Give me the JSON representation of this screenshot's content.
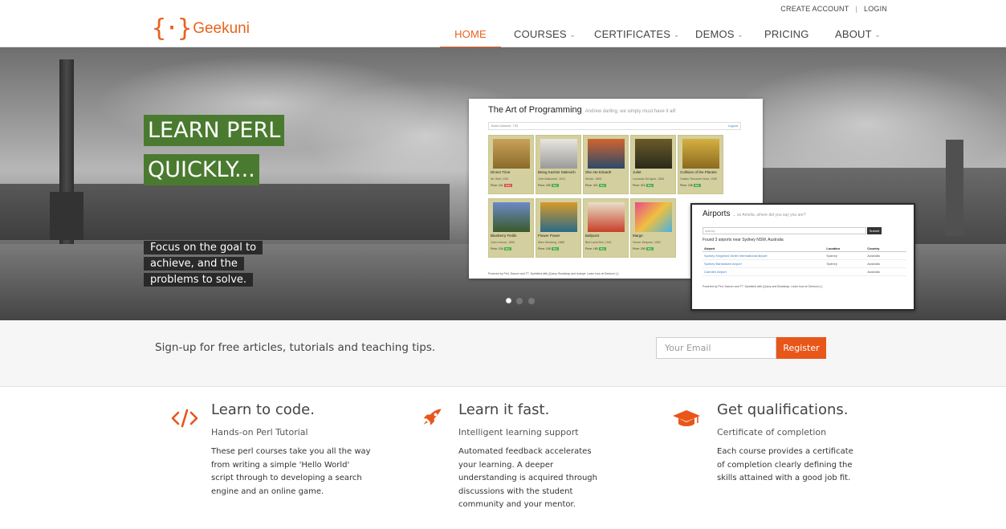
{
  "brand": {
    "mark": "{·}",
    "name": "Geekuni",
    "accent": "#e8631e"
  },
  "toplinks": {
    "create_account": "CREATE ACCOUNT",
    "separator": "|",
    "login": "LOGIN"
  },
  "nav": {
    "items": [
      {
        "label": "HOME",
        "active": true,
        "dropdown": false
      },
      {
        "label": "COURSES",
        "active": false,
        "dropdown": true
      },
      {
        "label": "CERTIFICATES",
        "active": false,
        "dropdown": true
      },
      {
        "label": "DEMOS",
        "active": false,
        "dropdown": true
      },
      {
        "label": "PRICING",
        "active": false,
        "dropdown": false
      },
      {
        "label": "ABOUT",
        "active": false,
        "dropdown": true
      }
    ],
    "chevron": "⌄"
  },
  "hero": {
    "title_line1": "LEARN PERL",
    "title_line2": "QUICKLY...",
    "subtitle": "Focus on the goal to achieve, and the problems to solve.",
    "title_bg": "#4a7a2f",
    "slide_count": 3,
    "active_slide": 1
  },
  "shot1": {
    "title": "The Art of Programming",
    "tagline": "Andrew darling, we simply must have it all!",
    "balance": "Bank balance: 733",
    "logout": "Logout",
    "cards": [
      {
        "name": "Dinner Time",
        "author": "Mr. Wolf, 1931",
        "price": "Price: 161",
        "tag": "Sold",
        "tag_color": "red"
      },
      {
        "name": "Being Kazimir Malevich",
        "author": "John Malkovich, 1913",
        "price": "Price: 180",
        "tag": "Buy",
        "tag_color": "green"
      },
      {
        "name": "She Ate Edvard!",
        "author": "Munch, 1893",
        "price": "Price: 321",
        "tag": "Buy",
        "tag_color": "green"
      },
      {
        "name": "Juliet",
        "author": "Leonardo DiCaprio, 1506",
        "price": "Price: 310",
        "tag": "Buy",
        "tag_color": "green"
      },
      {
        "name": "Collision of the Planets",
        "author": "Gustav Theodore Holst, 1908",
        "price": "Price: 238",
        "tag": "Buy",
        "tag_color": "green"
      },
      {
        "name": "Blueberry Fields",
        "author": "John Lennon, 1890",
        "price": "Price: 234",
        "tag": "Buy",
        "tag_color": "green"
      },
      {
        "name": "Flower Power",
        "author": "Allen Ginsberg, 1888",
        "price": "Price: 155",
        "tag": "Buy",
        "tag_color": "green"
      },
      {
        "name": "Ballpoint",
        "author": "Bird Lásló Biró, 1940",
        "price": "Price: 180",
        "tag": "Buy",
        "tag_color": "green"
      },
      {
        "name": "Marge",
        "author": "Homer Simpson, 1962",
        "price": "Price: 290",
        "tag": "Buy",
        "tag_color": "green"
      }
    ],
    "footer": "Powered by Perl, Dancer and TT. Sprinkled with jQuery, Bootstrap and Isotope. Learn how at Geekuni {·}."
  },
  "shot2": {
    "title": "Airports",
    "tagline": "... so Amelia, where did you say you are?",
    "input_value": "sydney",
    "submit": "Submit",
    "found": "Found 3 airports near Sydney NSW, Australia",
    "columns": [
      "Airport",
      "Location",
      "Country"
    ],
    "rows": [
      [
        "Sydney Kingsford Smith International Airport",
        "Sydney",
        "Australia"
      ],
      [
        "Sydney Bankstown Airport",
        "Sydney",
        "Australia"
      ],
      [
        "Camden Airport",
        "",
        "Australia"
      ]
    ],
    "footer": "Powered by Perl, Dancer and TT. Sprinkled with jQuery and Bootstrap. Learn how at Geekuni {·}."
  },
  "signup": {
    "message": "Sign-up for free articles, tutorials and teaching tips.",
    "email_placeholder": "Your Email",
    "button": "Register",
    "button_color": "#e8561a"
  },
  "features": [
    {
      "icon": "code-icon",
      "title": "Learn to code.",
      "subtitle": "Hands-on Perl Tutorial",
      "body": "These perl courses take you all the way from writing a simple 'Hello World' script through to developing a search engine and an online game."
    },
    {
      "icon": "rocket-icon",
      "title": "Learn it fast.",
      "subtitle": "Intelligent learning support",
      "body": "Automated feedback accelerates your learning. A deeper understanding is acquired through discussions with the student community and your mentor."
    },
    {
      "icon": "graduation-cap-icon",
      "title": "Get qualifications.",
      "subtitle": "Certificate of completion",
      "body": "Each course provides a certificate of completion clearly defining the skills attained with a good job fit."
    }
  ]
}
